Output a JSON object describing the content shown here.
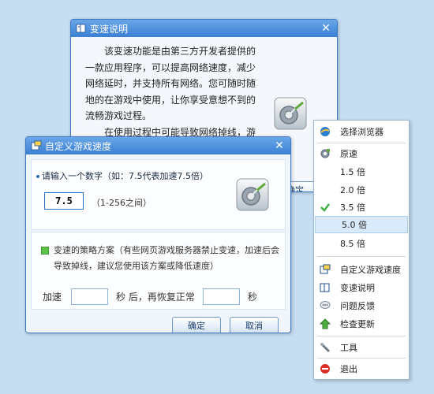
{
  "explain_window": {
    "title": "变速说明",
    "close": "✕",
    "paragraph1": "该变速功能是由第三方开发者提供的一款应用程序，可以提高网络速度，减少网络延时，并支持所有网络。您可随时随地的在游戏中使用，让你享受意想不到的流畅游戏过程。",
    "paragraph2": "在使用过程中可能导致网络掉线，游戏",
    "partial_button": "确定"
  },
  "custom_window": {
    "title": "自定义游戏速度",
    "close": "✕",
    "prompt": "请输入一个数字（如：7.5代表加速7.5倍）",
    "speed_value": "7.5",
    "range_hint": "（1-256之间）",
    "strategy_note": "变速的策略方案（有些网页游戏服务器禁止变速，加速后会导致掉线，建议您使用该方案或降低速度）",
    "accel_label": "加速",
    "sec_after_label": "秒 后，再恢复正常",
    "sec_label": "秒",
    "ok": "确定",
    "cancel": "取消"
  },
  "menu": {
    "items": [
      {
        "label": "选择浏览器",
        "icon": "browser-icon"
      },
      {
        "label": "原速",
        "icon": "gear-icon"
      },
      {
        "label": "1.5 倍",
        "icon": ""
      },
      {
        "label": "2.0 倍",
        "icon": ""
      },
      {
        "label": "3.5 倍",
        "icon": "checkmark-icon"
      },
      {
        "label": "5.0 倍",
        "icon": ""
      },
      {
        "label": "8.5 倍",
        "icon": ""
      },
      {
        "label": "自定义游戏速度",
        "icon": "custom-speed-icon"
      },
      {
        "label": "变速说明",
        "icon": "book-icon"
      },
      {
        "label": "问题反馈",
        "icon": "feedback-icon"
      },
      {
        "label": "检查更新",
        "icon": "update-icon"
      },
      {
        "label": "工具",
        "icon": "tool-icon"
      },
      {
        "label": "退出",
        "icon": "exit-icon"
      }
    ]
  },
  "colors": {
    "title_bar": "#3a80d4",
    "check_green": "#3cb043",
    "exit_red": "#d9302b",
    "selected_row": "#d9ebfa"
  }
}
